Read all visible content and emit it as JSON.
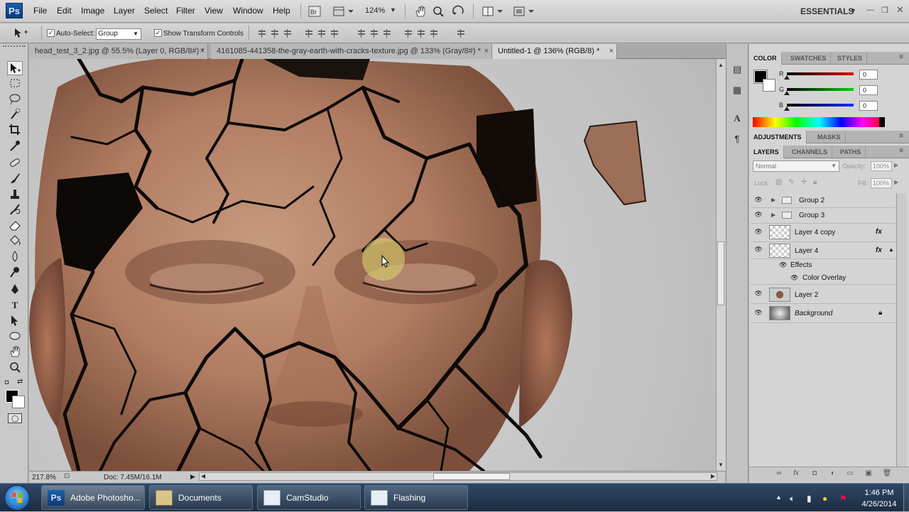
{
  "app": {
    "logo": "Ps"
  },
  "menu": [
    "File",
    "Edit",
    "Image",
    "Layer",
    "Select",
    "Filter",
    "View",
    "Window",
    "Help"
  ],
  "menubar": {
    "zoom": "124%",
    "workspace": "ESSENTIALS",
    "zoom_icon": "chevron-down-icon"
  },
  "options": {
    "auto_select_label": "Auto-Select:",
    "auto_select_value": "Group",
    "transform_label": "Show Transform Controls",
    "auto_select_checked": "✓",
    "transform_checked": "✓"
  },
  "doc_tabs": [
    {
      "label": "head_test_3_2.jpg @ 55.5% (Layer 0, RGB/8#) *",
      "close": "×"
    },
    {
      "label": "4161085-441358-the-gray-earth-with-cracks-texture.jpg @ 133% (Gray/8#) *",
      "close": "×"
    },
    {
      "label": "Untitled-1 @ 136% (RGB/8) *",
      "close": "×"
    }
  ],
  "status": {
    "zoom": "217.8%",
    "doc": "Doc: 7.45M/16.1M"
  },
  "color_panel": {
    "tabs": [
      "COLOR",
      "SWATCHES",
      "STYLES"
    ],
    "channels": [
      {
        "name": "R",
        "value": "0",
        "color": "#d40000"
      },
      {
        "name": "G",
        "value": "0",
        "color": "#00c000"
      },
      {
        "name": "B",
        "value": "0",
        "color": "#1030ff"
      }
    ]
  },
  "adjust_tabs": [
    "ADJUSTMENTS",
    "MASKS"
  ],
  "layers_panel": {
    "tabs": [
      "LAYERS",
      "CHANNELS",
      "PATHS"
    ],
    "blend_mode": "Normal",
    "opacity_label": "Opacity:",
    "opacity_value": "100%",
    "lock_label": "Lock:",
    "fill_label": "Fill:",
    "fill_value": "100%",
    "layers": [
      {
        "name": "Group 2",
        "kind": "group"
      },
      {
        "name": "Group 3",
        "kind": "group"
      },
      {
        "name": "Layer 4 copy",
        "kind": "layer",
        "fx": "fx"
      },
      {
        "name": "Layer 4",
        "kind": "layer",
        "fx": "fx"
      },
      {
        "name": "Effects",
        "kind": "effects"
      },
      {
        "name": "Color Overlay",
        "kind": "effect"
      },
      {
        "name": "Layer 2",
        "kind": "layer"
      },
      {
        "name": "Background",
        "kind": "background"
      }
    ]
  },
  "taskbar": {
    "items": [
      {
        "label": "Adobe Photosho...",
        "icon": "photoshop-icon"
      },
      {
        "label": "Documents",
        "icon": "folder-icon"
      },
      {
        "label": "CamStudio",
        "icon": "camstudio-icon"
      },
      {
        "label": "Flashing",
        "icon": "window-icon"
      }
    ],
    "time": "1:46 PM",
    "date": "4/26/2014"
  }
}
